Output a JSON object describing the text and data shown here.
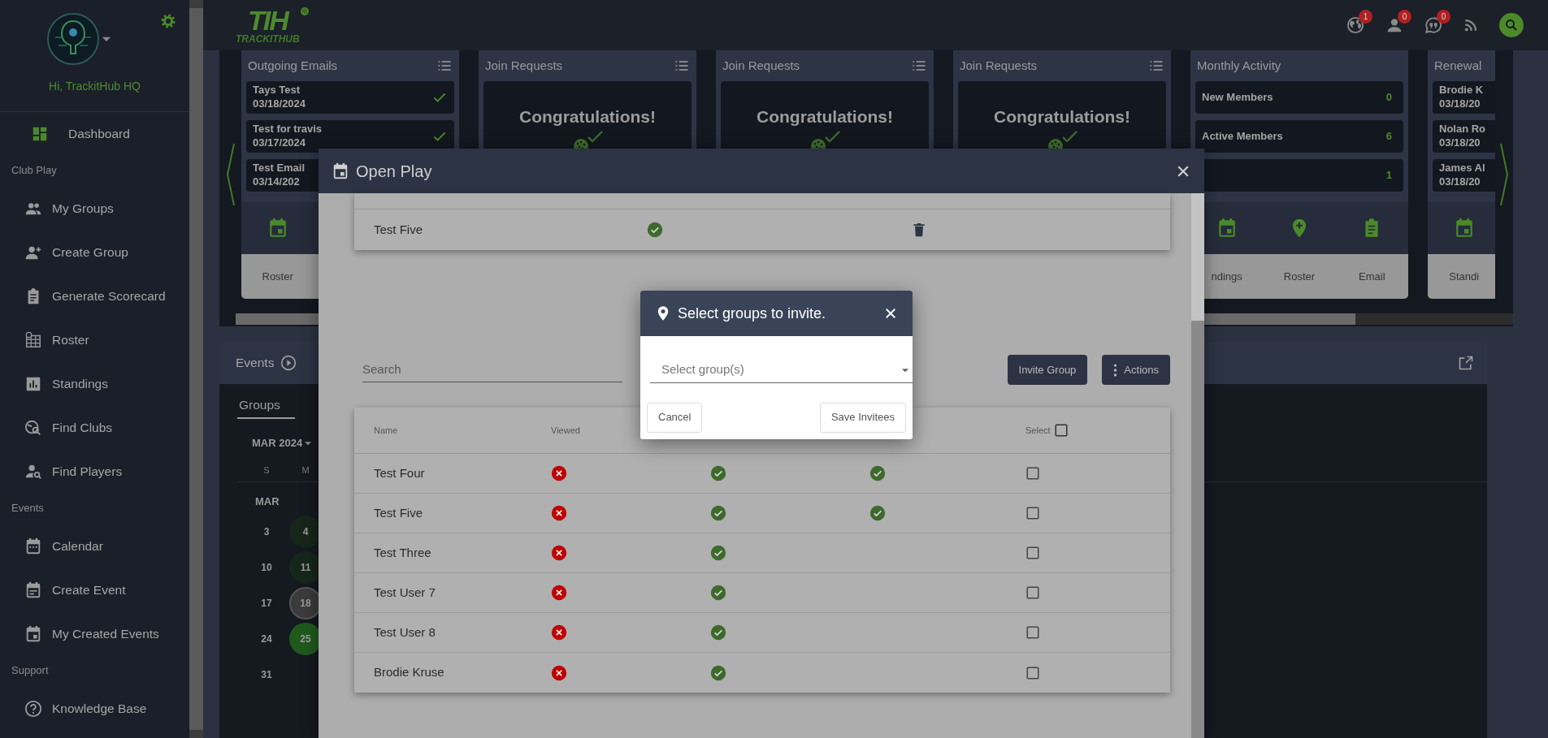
{
  "sidebar": {
    "greeting": "Hi, TrackitHub HQ",
    "items": [
      {
        "kind": "link",
        "label": "Dashboard",
        "selected": true
      },
      {
        "kind": "heading",
        "label": "Club Play"
      },
      {
        "kind": "link",
        "label": "My Groups",
        "selected": false
      },
      {
        "kind": "link",
        "label": "Create Group",
        "selected": false
      },
      {
        "kind": "link",
        "label": "Generate Scorecard",
        "selected": false
      },
      {
        "kind": "link",
        "label": "Roster",
        "selected": false
      },
      {
        "kind": "link",
        "label": "Standings",
        "selected": false
      },
      {
        "kind": "link",
        "label": "Find Clubs",
        "selected": false
      },
      {
        "kind": "link",
        "label": "Find Players",
        "selected": false
      },
      {
        "kind": "heading",
        "label": "Events"
      },
      {
        "kind": "link",
        "label": "Calendar",
        "selected": false
      },
      {
        "kind": "link",
        "label": "Create Event",
        "selected": false
      },
      {
        "kind": "link",
        "label": "My Created Events",
        "selected": false
      },
      {
        "kind": "heading",
        "label": "Support"
      },
      {
        "kind": "link",
        "label": "Knowledge Base",
        "selected": false
      }
    ]
  },
  "topbar": {
    "logo_mark": "TIH",
    "logo_text": "TRACKITHUB",
    "notifications": [
      {
        "count": "1"
      },
      {
        "count": "0"
      },
      {
        "count": "0"
      }
    ]
  },
  "cards": [
    {
      "kind": "list",
      "title": "Outgoing Emails",
      "rows": [
        {
          "name": "Tays Test",
          "date": "03/18/2024",
          "sent": true
        },
        {
          "name": "Test for travis",
          "date": "03/17/2024",
          "sent": true
        },
        {
          "name": "Test Email",
          "date": "03/14/202"
        }
      ],
      "footer": [
        "Roster"
      ]
    },
    {
      "kind": "congrats",
      "title": "Join Requests",
      "message": "Congratulations!"
    },
    {
      "kind": "congrats",
      "title": "Join Requests",
      "message": "Congratulations!"
    },
    {
      "kind": "congrats",
      "title": "Join Requests",
      "message": "Congratulations!"
    },
    {
      "kind": "stats",
      "title": "Monthly Activity",
      "rows": [
        {
          "label": "New Members",
          "value": "0"
        },
        {
          "label": "Active Members",
          "value": "6"
        },
        {
          "value": "1"
        }
      ],
      "footer": [
        "ndings",
        "Roster",
        "Email"
      ]
    },
    {
      "kind": "list",
      "title": "Renewal",
      "rows": [
        {
          "name": "Brodie K",
          "date": "03/18/20"
        },
        {
          "name": "Nolan Ro",
          "date": "03/18/20"
        },
        {
          "name": "James Al",
          "date": "03/18/20"
        }
      ],
      "footer": [
        "Standi"
      ]
    }
  ],
  "events": {
    "title": "Events",
    "tab": {
      "label": "Groups",
      "selected": true
    },
    "month": "MAR 2024",
    "weekdays": [
      "S",
      "M"
    ],
    "month_label": "MAR",
    "weeks": [
      [
        {
          "day": "3",
          "kind": "plain"
        },
        {
          "day": "4",
          "kind": "event"
        }
      ],
      [
        {
          "day": "10",
          "kind": "plain"
        },
        {
          "day": "11",
          "kind": "event"
        }
      ],
      [
        {
          "day": "17",
          "kind": "plain"
        },
        {
          "day": "18",
          "kind": "today"
        }
      ],
      [
        {
          "day": "24",
          "kind": "plain"
        },
        {
          "day": "25",
          "kind": "highlight"
        }
      ],
      [
        {
          "day": "31",
          "kind": "plain"
        }
      ]
    ]
  },
  "open_play": {
    "title": "Open Play",
    "top_rows": [
      {
        "name": "Test Five",
        "confirmed": true
      }
    ],
    "search": {
      "placeholder": "Search"
    },
    "buttons": [
      {
        "kind": "plain",
        "label": "Invite Group"
      },
      {
        "kind": "menu",
        "label": "Actions"
      }
    ],
    "table": {
      "columns": [
        "Name",
        "Viewed"
      ],
      "select_label": "Select",
      "select_all": false,
      "rows": [
        {
          "name": "Test Four",
          "viewed": false,
          "column_3": true,
          "column_4": true,
          "selected": false
        },
        {
          "name": "Test Five",
          "viewed": false,
          "column_3": true,
          "column_4": true,
          "selected": false
        },
        {
          "name": "Test Three",
          "viewed": false,
          "column_3": true,
          "column_4": false,
          "selected": false
        },
        {
          "name": "Test User 7",
          "viewed": false,
          "column_3": true,
          "column_4": false,
          "selected": false
        },
        {
          "name": "Test User 8",
          "viewed": false,
          "column_3": true,
          "column_4": false,
          "selected": false
        },
        {
          "name": "Brodie Kruse",
          "viewed": false,
          "column_3": true,
          "column_4": false,
          "selected": false
        }
      ]
    }
  },
  "invite_dialog": {
    "title": "Select groups to invite.",
    "select": {
      "placeholder": "Select group(s)"
    },
    "buttons": [
      "Cancel",
      "Save Invitees"
    ]
  }
}
